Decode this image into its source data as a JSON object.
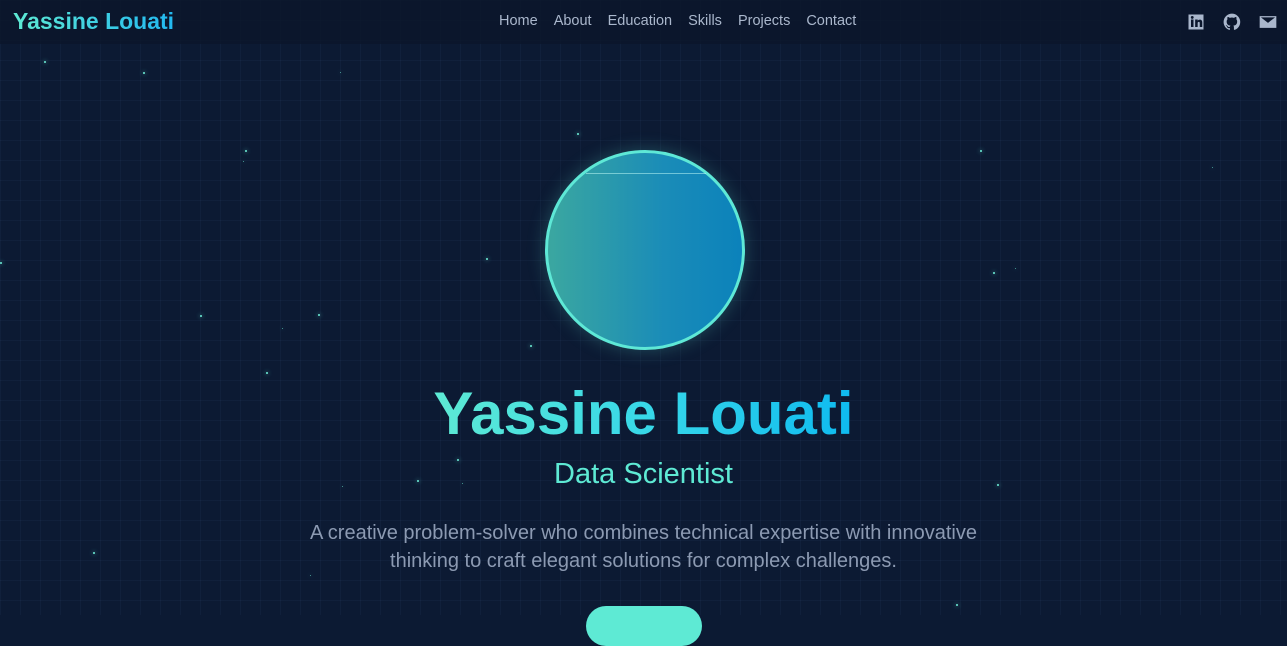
{
  "brand": "Yassine Louati",
  "nav": [
    "Home",
    "About",
    "Education",
    "Skills",
    "Projects",
    "Contact"
  ],
  "socials": [
    "linkedin-icon",
    "github-icon",
    "mail-icon"
  ],
  "hero": {
    "name": "Yassine Louati",
    "role": "Data Scientist",
    "description": "A creative problem-solver who combines technical expertise with innovative thinking to craft elegant solutions for complex challenges."
  },
  "colors": {
    "background": "#0c1a33",
    "accent": "#5eead4",
    "accent_blue": "#0ebaf0",
    "nav_text": "#aab7cc",
    "muted_text": "#8c9ab2"
  }
}
